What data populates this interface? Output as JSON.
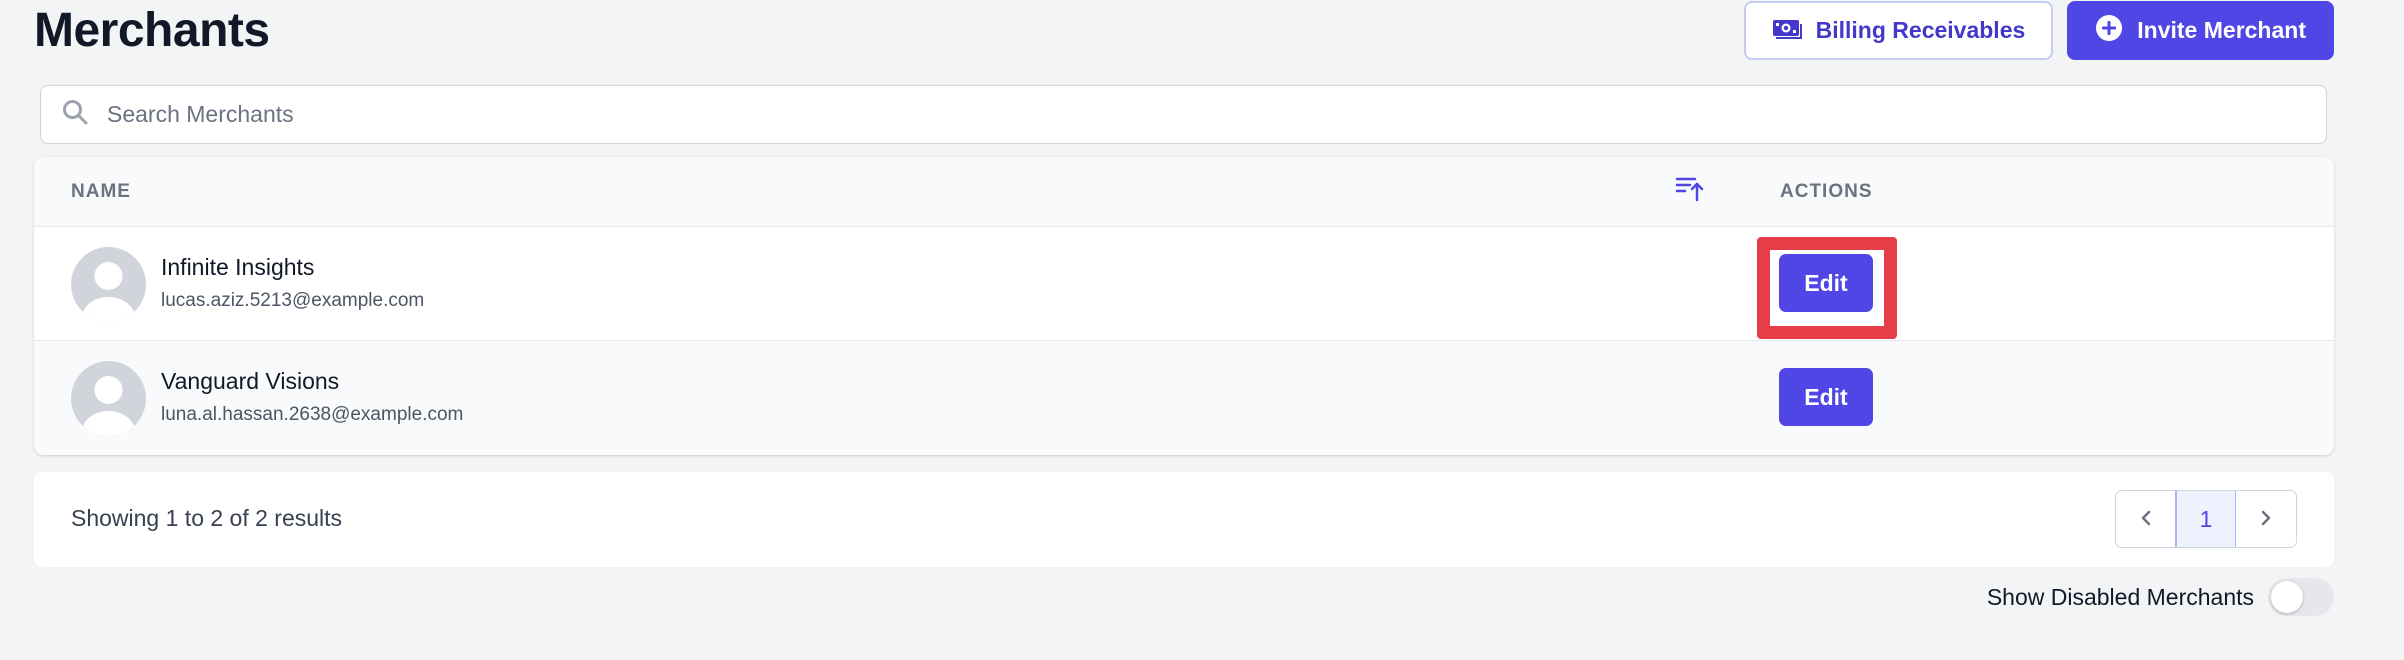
{
  "page": {
    "title": "Merchants"
  },
  "header": {
    "billing_button": "Billing Receivables",
    "invite_button": "Invite Merchant"
  },
  "search": {
    "placeholder": "Search Merchants",
    "value": ""
  },
  "table": {
    "columns": {
      "name": "NAME",
      "actions": "ACTIONS"
    },
    "rows": [
      {
        "name": "Infinite Insights",
        "email": "lucas.aziz.5213@example.com",
        "action": "Edit",
        "highlighted": true
      },
      {
        "name": "Vanguard Visions",
        "email": "luna.al.hassan.2638@example.com",
        "action": "Edit",
        "highlighted": false
      }
    ]
  },
  "footer": {
    "showing_text": "Showing 1 to 2 of 2 results",
    "current_page": "1"
  },
  "toggle": {
    "label": "Show Disabled Merchants",
    "enabled": false
  },
  "icons": {
    "billing": "banknote-icon",
    "invite": "plus-circle-icon",
    "search": "search-icon",
    "sort": "sort-ascending-icon",
    "avatar": "user-avatar-placeholder",
    "prev": "chevron-left-icon",
    "next": "chevron-right-icon"
  },
  "colors": {
    "accent": "#4f46e5",
    "highlight": "#e53e48",
    "background": "#f3f4f6"
  }
}
